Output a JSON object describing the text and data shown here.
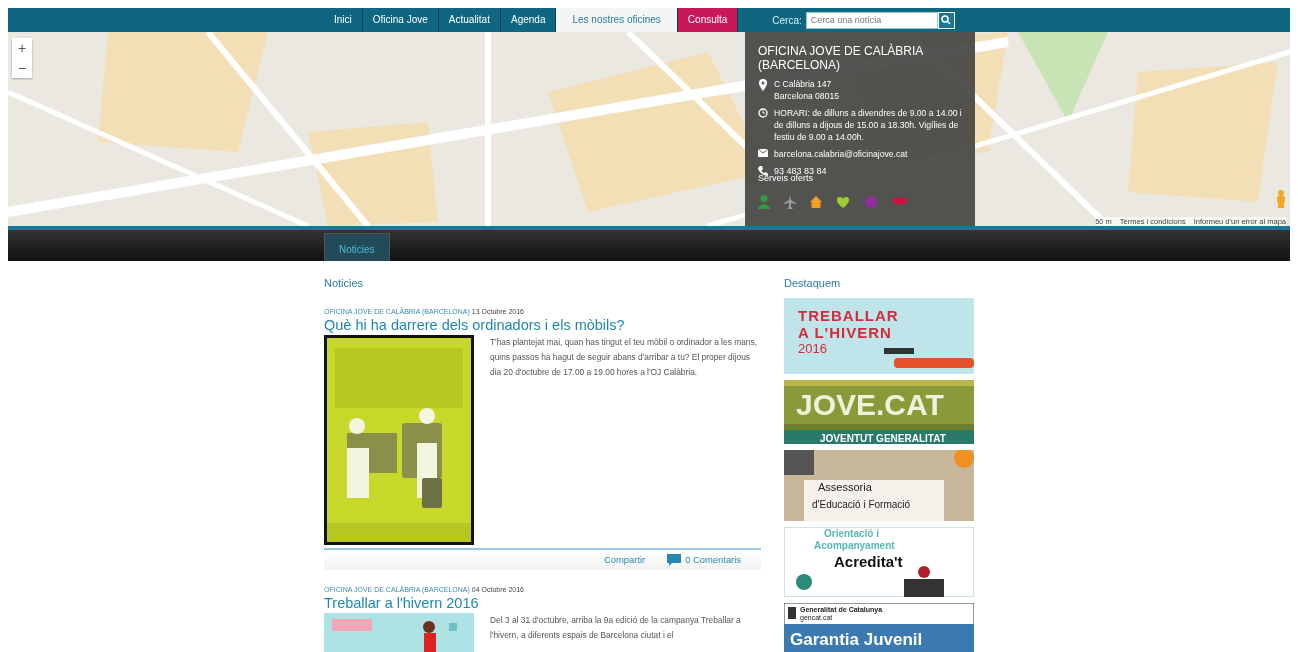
{
  "nav": {
    "items": [
      {
        "label": "Inici",
        "selected": false,
        "highlight": false
      },
      {
        "label": "Oficina Jove",
        "selected": false,
        "highlight": false
      },
      {
        "label": "Actualitat",
        "selected": false,
        "highlight": false
      },
      {
        "label": "Agenda",
        "selected": false,
        "highlight": false
      },
      {
        "label": "Les nostres oficines",
        "selected": true,
        "highlight": false
      },
      {
        "label": "Consulta",
        "selected": false,
        "highlight": true
      }
    ],
    "search": {
      "label": "Cerca:",
      "placeholder": "Cerca una notícia"
    }
  },
  "map": {
    "zoom_in": "+",
    "zoom_out": "−",
    "scale": "50 m",
    "links": [
      "Termes i condicions",
      "Informeu d'un error al mapa"
    ]
  },
  "office": {
    "title": "OFICINA JOVE DE CALÀBRIA (BARCELONA)",
    "address": [
      "C Calàbria 147",
      "Barcelona 08015"
    ],
    "hours": "HORARI: de dilluns a divendres de 9.00 a 14.00 i de dilluns a dijous de 15.00 a 18.30h. Vigílies de festiu de 9.00 a 14.00h.",
    "email": "barcelona.calabria@oficinajove.cat",
    "phone": "93 483 83 84",
    "services_label": "Serveis oferts",
    "services": [
      {
        "kind": "person",
        "color": "#2e9e3e"
      },
      {
        "kind": "plane",
        "color": "#9a9a9a"
      },
      {
        "kind": "house",
        "color": "#f0a020"
      },
      {
        "kind": "heart",
        "color": "#9acd32"
      },
      {
        "kind": "flower",
        "color": "#8e2ea0"
      },
      {
        "kind": "lips",
        "color": "#d0103a"
      }
    ]
  },
  "subnav": [
    {
      "label": "Noticies",
      "selected": true
    }
  ],
  "news": {
    "heading": "Noticies",
    "articles": [
      {
        "source": "OFICINA JOVE DE CALÀBRIA (BARCELONA)",
        "date": "13 Octubre 2016",
        "title": "Què hi ha darrere dels ordinadors i els mòbils?",
        "text": "T'has plantejat mai, quan has tingut el teu mòbil o ordinador a les mans, quins passos ha hagut de seguir abans d'arribar a tu? El proper dijous dia 20 d'octubre de 17.00 a 19.00 hores a l'OJ Calàbria.",
        "kind": "poster",
        "share": "Compartir",
        "comments": "0 Comentaris"
      },
      {
        "source": "OFICINA JOVE DE CALÀBRIA (BARCELONA)",
        "date": "04 Octubre 2016",
        "title": "Treballar a l'hivern 2016",
        "text": "Del 3 al 31 d'octubre, arriba la 9a edició de la campanya Treballar a l'hivern, a diferents espais de Barcelona ciutat i el",
        "kind": "banner"
      }
    ]
  },
  "featured": {
    "heading": "Destaquem",
    "banners": [
      {
        "kind": "hivern",
        "lines": [
          "TREBALLAR",
          "A L'HIVERN",
          "2016"
        ]
      },
      {
        "kind": "jove",
        "lines": [
          "JOVE.CAT",
          "JOVENTUT GENERALITAT"
        ]
      },
      {
        "kind": "assessoria",
        "lines": [
          "Assessoria",
          "d'Educació  i Formació"
        ]
      },
      {
        "kind": "acredita",
        "lines": [
          "Orientació   i",
          "Acompanyament",
          "Acredita't"
        ]
      },
      {
        "kind": "garantia",
        "lines": [
          "Generalitat de Catalunya",
          "gencat.cat",
          "Garantia Juvenil"
        ]
      }
    ]
  }
}
